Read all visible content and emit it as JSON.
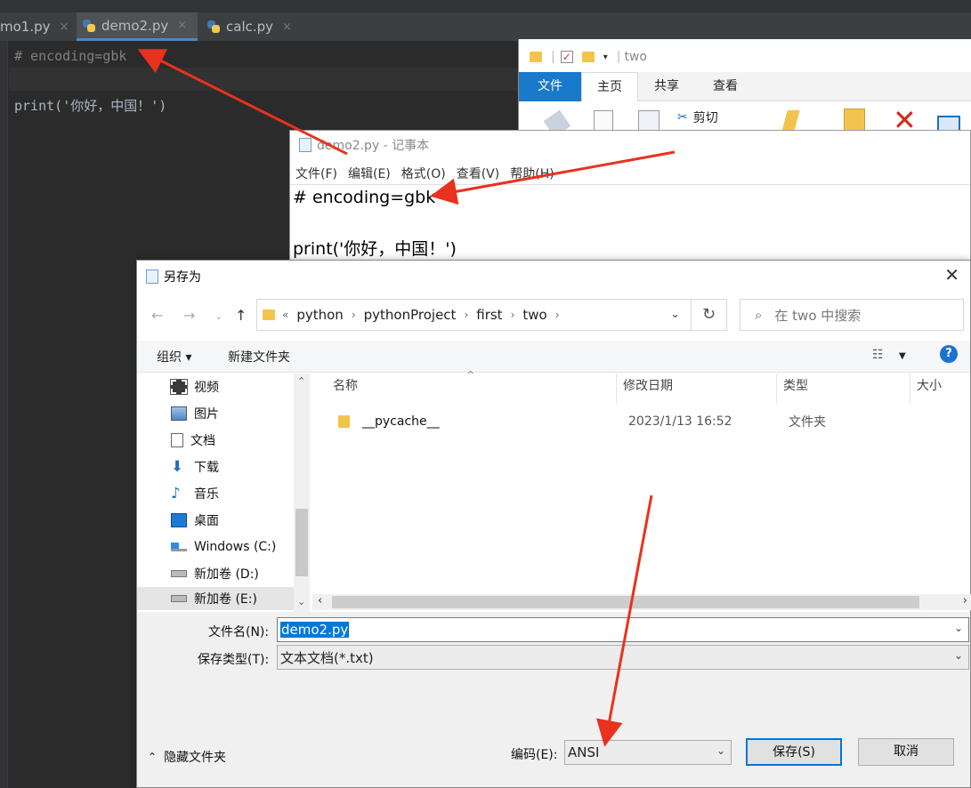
{
  "ide": {
    "tabs": [
      {
        "label": "mo1.py",
        "close": "×"
      },
      {
        "label": "demo2.py",
        "close": "×"
      },
      {
        "label": "calc.py",
        "close": "×"
      }
    ],
    "code_lines": [
      "# encoding=gbk",
      "",
      "print('你好，中国！')"
    ]
  },
  "explorer": {
    "qa_title": "two",
    "ribbon_tabs": [
      "文件",
      "主页",
      "共享",
      "查看"
    ],
    "ribbon_cut": "剪切"
  },
  "notepad": {
    "title": "demo2.py - 记事本",
    "menu": [
      "文件(F)",
      "编辑(E)",
      "格式(O)",
      "查看(V)",
      "帮助(H)"
    ],
    "lines": [
      "# encoding=gbk",
      "",
      "print('你好，中国！')"
    ]
  },
  "dialog": {
    "title": "另存为",
    "close": "✕",
    "breadcrumb": [
      "python",
      "pythonProject",
      "first",
      "two"
    ],
    "breadcrumb_prefix": "«",
    "search_placeholder": "在 two 中搜索",
    "toolbar": {
      "organize": "组织 ▾",
      "new_folder": "新建文件夹",
      "help": "?"
    },
    "nav_items": [
      {
        "label": "视频",
        "icon": "video-icon"
      },
      {
        "label": "图片",
        "icon": "picture-icon"
      },
      {
        "label": "文档",
        "icon": "document-icon"
      },
      {
        "label": "下载",
        "icon": "download-icon"
      },
      {
        "label": "音乐",
        "icon": "music-icon"
      },
      {
        "label": "桌面",
        "icon": "desktop-icon"
      },
      {
        "label": "Windows (C:)",
        "icon": "windows-drive-icon"
      },
      {
        "label": "新加卷 (D:)",
        "icon": "drive-icon"
      },
      {
        "label": "新加卷 (E:)",
        "icon": "drive-icon"
      }
    ],
    "columns": [
      "名称",
      "修改日期",
      "类型",
      "大小"
    ],
    "files": [
      {
        "name": "__pycache__",
        "date": "2023/1/13 16:52",
        "type": "文件夹"
      }
    ],
    "filename_label": "文件名(N):",
    "filename_value": "demo2.py",
    "filetype_label": "保存类型(T):",
    "filetype_value": "文本文档(*.txt)",
    "hide_folders": "隐藏文件夹",
    "encoding_label": "编码(E):",
    "encoding_value": "ANSI",
    "save_button": "保存(S)",
    "cancel_button": "取消"
  },
  "colors": {
    "accent": "#1979ca",
    "arrow": "#e8321e",
    "ide_bg": "#2b2b2b"
  }
}
